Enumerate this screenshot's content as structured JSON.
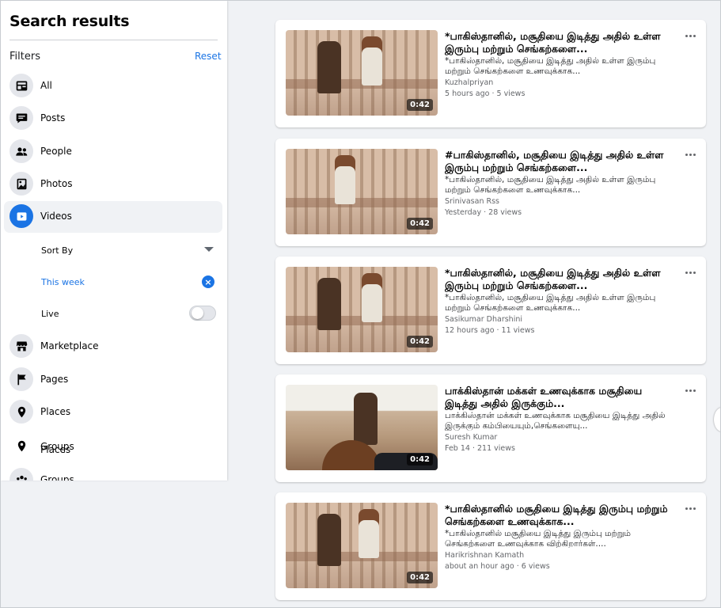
{
  "sidebar": {
    "title": "Search results",
    "filters_label": "Filters",
    "reset_label": "Reset",
    "nav": [
      {
        "label": "All",
        "icon": "feed-icon"
      },
      {
        "label": "Posts",
        "icon": "posts-icon"
      },
      {
        "label": "People",
        "icon": "people-icon"
      },
      {
        "label": "Photos",
        "icon": "photos-icon"
      },
      {
        "label": "Videos",
        "icon": "video-play-icon"
      },
      {
        "label": "Marketplace",
        "icon": "marketplace-icon"
      },
      {
        "label": "Pages",
        "icon": "flag-icon"
      },
      {
        "label": "Places",
        "icon": "map-pin-icon"
      },
      {
        "label": "Groups",
        "icon": "groups-icon"
      }
    ],
    "sort_by_label": "Sort By",
    "date_filter_value": "This week",
    "live_label": "Live",
    "overlap_label_a": "Groups",
    "overlap_label_b": "Places",
    "accent_color": "#1b74e4"
  },
  "results": [
    {
      "title": "*பாகிஸ்தானில், மசூதியை இடித்து அதில் உள்ள இரும்பு மற்றும் செங்கற்களை...",
      "description": "*பாகிஸ்தானில், மசூதியை இடித்து அதில் உள்ள இரும்பு மற்றும் செங்கற்களை உணவுக்காக...",
      "author": "Kuzhalpriyan",
      "meta": "5 hours ago · 5 views",
      "duration": "0:42"
    },
    {
      "title": "#பாகிஸ்தானில், மசூதியை இடித்து அதில் உள்ள இரும்பு மற்றும் செங்கற்களை...",
      "description": "*பாகிஸ்தானில், மசூதியை இடித்து அதில் உள்ள இரும்பு மற்றும் செங்கற்களை உணவுக்காக...",
      "author": "Srinivasan Rss",
      "meta": "Yesterday · 28 views",
      "duration": "0:42"
    },
    {
      "title": "*பாகிஸ்தானில், மசூதியை இடித்து அதில் உள்ள இரும்பு மற்றும் செங்கற்களை...",
      "description": "*பாகிஸ்தானில், மசூதியை இடித்து அதில் உள்ள இரும்பு மற்றும் செங்கற்களை உணவுக்காக...",
      "author": "Sasikumar Dharshini",
      "meta": "12 hours ago · 11 views",
      "duration": "0:42"
    },
    {
      "title": "பாக்கிஸ்தான் மக்கள் உணவுக்காக மசூதியை இடித்து அதில் இருக்கும்...",
      "description": "பாக்கிஸ்தான் மக்கள் உணவுக்காக மசூதியை இடித்து அதில் இருக்கும் கம்பியையும்,செங்களையு...",
      "author": "Suresh Kumar",
      "meta": "Feb 14 · 211 views",
      "duration": "0:42"
    },
    {
      "title": "*பாகிஸ்தானில் மசூதியை இடித்து இரும்பு மற்றும் செங்கற்களை உணவுக்காக...",
      "description": "*பாகிஸ்தானில் மசூதியை இடித்து இரும்பு மற்றும் செங்கற்களை உணவுக்காக விற்கிறார்கள்....",
      "author": "Harikrishnan Kamath",
      "meta": "about an hour ago · 6 views",
      "duration": "0:42"
    }
  ]
}
